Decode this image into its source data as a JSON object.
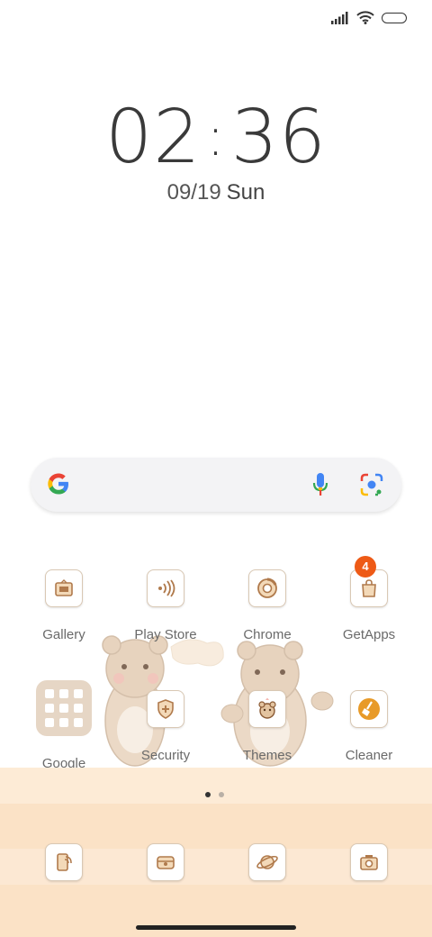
{
  "status_bar": {
    "icons": [
      "cellular-signal-icon",
      "wifi-icon",
      "battery-icon"
    ]
  },
  "lock": {
    "hours": "02",
    "separator": ":",
    "minutes": "36",
    "date": "09/19",
    "weekday": "Sun"
  },
  "search": {
    "icons": [
      "google-logo-icon",
      "mic-icon",
      "lens-camera-icon"
    ]
  },
  "apps": [
    {
      "label": "Gallery",
      "icon": "gallery-icon"
    },
    {
      "label": "Play Store",
      "icon": "play-store-icon"
    },
    {
      "label": "Chrome",
      "icon": "chrome-icon"
    },
    {
      "label": "GetApps",
      "icon": "getapps-icon",
      "badge": "4"
    },
    {
      "label": "Google",
      "icon": "google-folder-icon"
    },
    {
      "label": "Security",
      "icon": "security-icon"
    },
    {
      "label": "Themes",
      "icon": "themes-icon"
    },
    {
      "label": "Cleaner",
      "icon": "cleaner-icon"
    }
  ],
  "pager": {
    "pages": 2,
    "current": 1
  },
  "dock": [
    {
      "icon": "phone-icon"
    },
    {
      "icon": "messages-icon"
    },
    {
      "icon": "browser-icon"
    },
    {
      "icon": "camera-icon"
    }
  ],
  "colors": {
    "icon_brown": "#b07a4c",
    "badge": "#ee5a16",
    "dock_peach": "#fbe2c6"
  }
}
